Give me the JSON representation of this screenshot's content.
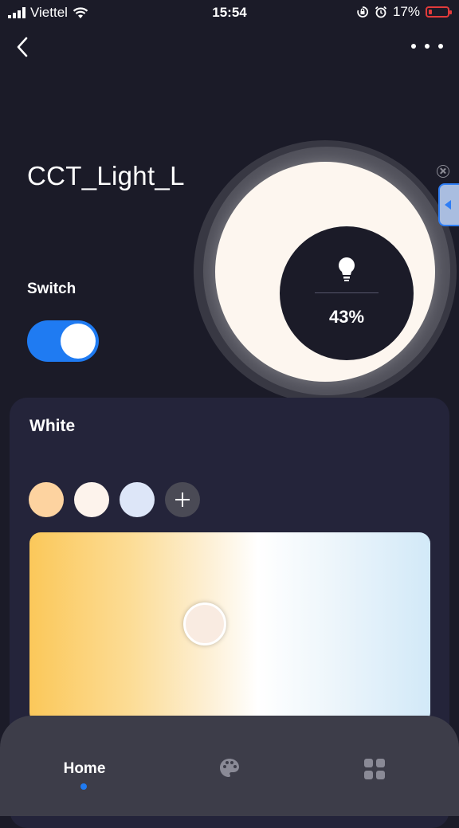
{
  "status_bar": {
    "carrier": "Viettel",
    "time": "15:54",
    "battery": "17%",
    "battery_level": 0.17,
    "icons": [
      "signal-icon",
      "wifi-icon",
      "orientation-lock-icon",
      "alarm-icon",
      "battery-icon"
    ]
  },
  "header": {
    "back_icon": "chevron-left-icon",
    "more_icon": "more-icon"
  },
  "device": {
    "name": "CCT_Light_L",
    "brightness": "43%",
    "bulb_icon": "lightbulb-icon"
  },
  "switch": {
    "label": "Switch",
    "on": true
  },
  "white_panel": {
    "title": "White",
    "swatches": [
      "#fdd3a0",
      "#fdf3ec",
      "#dde6f8"
    ],
    "add_icon": "plus-icon"
  },
  "nav": {
    "home_label": "Home",
    "icons": [
      "palette-icon",
      "grid-icon"
    ]
  },
  "colors": {
    "accent": "#1f7bf2",
    "background": "#1b1b28",
    "card": "#24243a"
  }
}
